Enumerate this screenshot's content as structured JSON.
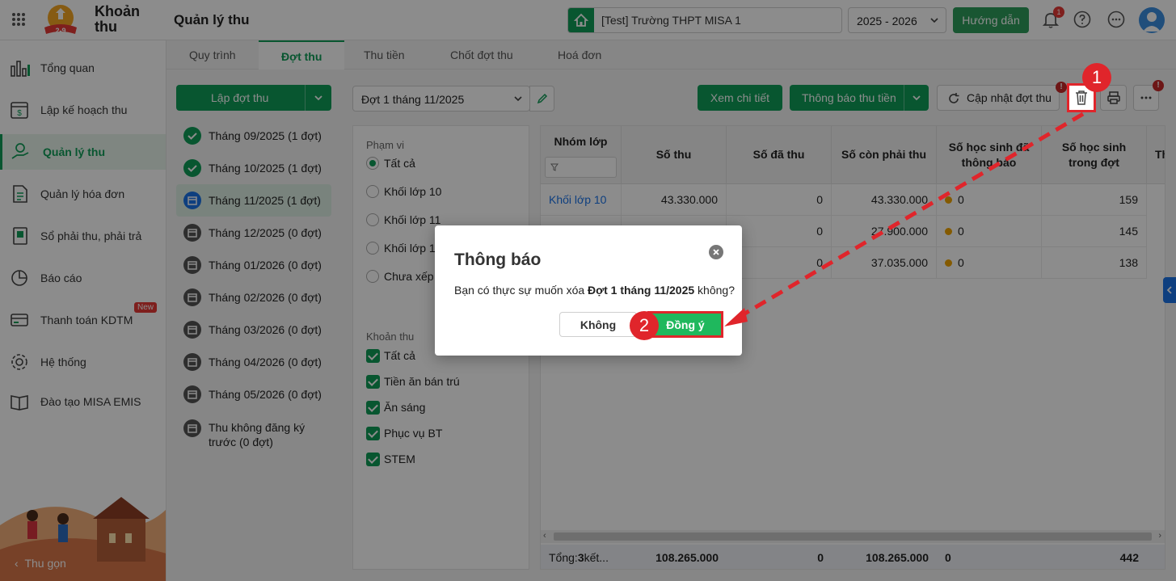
{
  "app": {
    "brand_line1": "Khoản",
    "brand_line2": "thu",
    "logo_text": "2-9",
    "page_title": "Quản lý thu"
  },
  "header": {
    "school": "[Test] Trường THPT MISA 1",
    "year": "2025 - 2026",
    "guide_label": "Hướng dẫn",
    "notification_count": "1"
  },
  "sidebar": {
    "items": [
      {
        "label": "Tổng quan",
        "icon": "bar-chart-icon"
      },
      {
        "label": "Lập kế hoạch thu",
        "icon": "calendar-dollar-icon"
      },
      {
        "label": "Quản lý thu",
        "icon": "hand-coin-icon"
      },
      {
        "label": "Quản lý hóa đơn",
        "icon": "document-icon"
      },
      {
        "label": "Sổ phải thu, phải trả",
        "icon": "ledger-icon"
      },
      {
        "label": "Báo cáo",
        "icon": "pie-chart-icon"
      },
      {
        "label": "Thanh toán KDTM",
        "icon": "card-icon"
      },
      {
        "label": "Hệ thống",
        "icon": "gear-icon"
      },
      {
        "label": "Đào tạo MISA EMIS",
        "icon": "book-icon"
      }
    ],
    "new_badge": "New",
    "collapse_label": "Thu gọn"
  },
  "tabs": [
    "Quy trình",
    "Đợt thu",
    "Thu tiền",
    "Chốt đợt thu",
    "Hoá đơn"
  ],
  "left_panel": {
    "create_button": "Lập đợt thu",
    "periods": [
      {
        "label": "Tháng 09/2025 (1 đợt)",
        "status": "done"
      },
      {
        "label": "Tháng 10/2025 (1 đợt)",
        "status": "done"
      },
      {
        "label": "Tháng 11/2025 (1 đợt)",
        "status": "active"
      },
      {
        "label": "Tháng 12/2025 (0 đợt)",
        "status": "pending"
      },
      {
        "label": "Tháng 01/2026 (0 đợt)",
        "status": "pending"
      },
      {
        "label": "Tháng 02/2026 (0 đợt)",
        "status": "pending"
      },
      {
        "label": "Tháng 03/2026 (0 đợt)",
        "status": "pending"
      },
      {
        "label": "Tháng 04/2026 (0 đợt)",
        "status": "pending"
      },
      {
        "label": "Tháng 05/2026 (0 đợt)",
        "status": "pending"
      }
    ],
    "extra_line1": "Thu không đăng ký",
    "extra_line2": "trước (0 đợt)"
  },
  "toolbar": {
    "period_select": "Đợt 1 tháng 11/2025",
    "view_detail": "Xem chi tiết",
    "notify": "Thông báo thu tiền",
    "update": "Cập nhật đợt thu",
    "alert_mark": "!"
  },
  "filters": {
    "scope_title": "Phạm vi",
    "scope_options": [
      "Tất cả",
      "Khối lớp 10",
      "Khối lớp 11",
      "Khối lớp 12",
      "Chưa xếp lớp"
    ],
    "scope_selected": "Tất cả",
    "fee_title": "Khoản thu",
    "fee_options": [
      "Tất cả",
      "Tiền ăn bán trú",
      "Ăn sáng",
      "Phục vụ BT",
      "STEM"
    ]
  },
  "table": {
    "headers": {
      "group": "Nhóm lớp",
      "amount": "Số thu",
      "paid": "Số đã thu",
      "remaining": "Số còn phải thu",
      "notified_1": "Số học sinh đã",
      "notified_2": "thông báo",
      "students_1": "Số học sinh",
      "students_2": "trong đợt",
      "more": "Th"
    },
    "rows": [
      {
        "group": "Khối lớp 10",
        "amount": "43.330.000",
        "paid": "0",
        "remaining": "43.330.000",
        "notified": "0",
        "students": "159"
      },
      {
        "group": "",
        "amount": "",
        "paid": "0",
        "remaining": "27.900.000",
        "notified": "0",
        "students": "145"
      },
      {
        "group": "",
        "amount": "",
        "paid": "0",
        "remaining": "37.035.000",
        "notified": "0",
        "students": "138"
      }
    ],
    "footer": {
      "label_prefix": "Tổng: ",
      "label_count": "3",
      "label_suffix": " kết...",
      "amount": "108.265.000",
      "paid": "0",
      "remaining": "108.265.000",
      "notified": "0",
      "students": "442"
    }
  },
  "dialog": {
    "title": "Thông báo",
    "msg_prefix": "Bạn có thực sự muốn xóa ",
    "msg_bold": "Đợt 1 tháng 11/2025",
    "msg_suffix": " không?",
    "no_label": "Không",
    "yes_label": "Đồng ý"
  },
  "annotations": {
    "step1": "1",
    "step2": "2",
    "highlight_color": "#e0252b"
  },
  "colors": {
    "primary": "#0f9d58",
    "link": "#1a73e8",
    "accent_red": "#e0252b",
    "pending_dot": "#f0a500"
  }
}
